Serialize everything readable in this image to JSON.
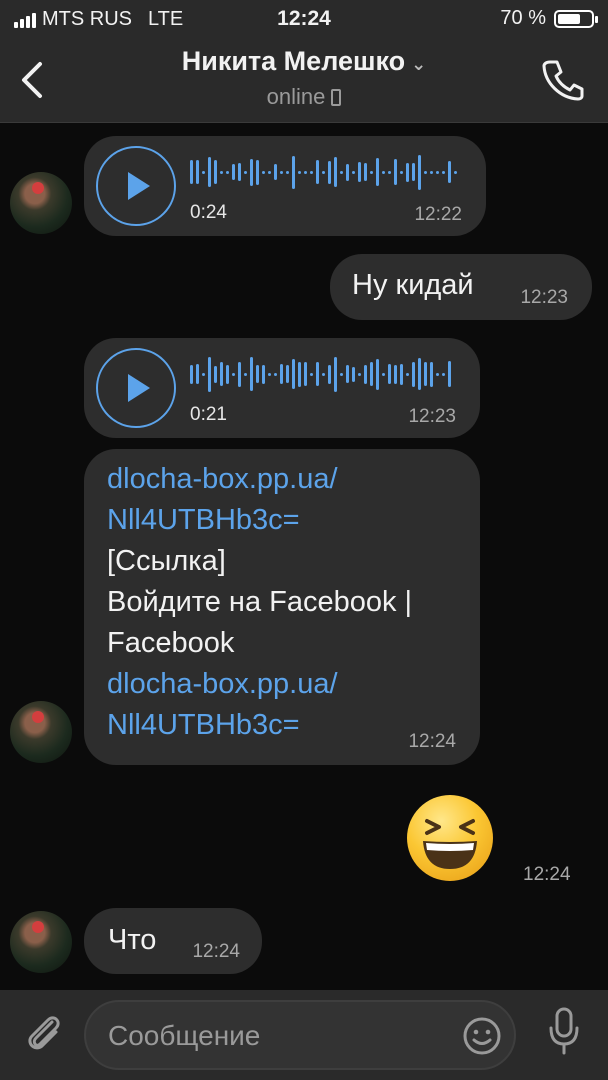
{
  "status_bar": {
    "carrier": "MTS RUS",
    "network": "LTE",
    "time": "12:24",
    "battery": "70 %",
    "battery_level": 0.7
  },
  "header": {
    "name": "Никита Мелешко",
    "status": "online",
    "back_icon": "chevron-left-icon",
    "call_icon": "phone-icon"
  },
  "messages": [
    {
      "type": "voice",
      "direction": "incoming",
      "duration": "0:24",
      "time": "12:22"
    },
    {
      "type": "text",
      "direction": "outgoing",
      "text": "Ну кидай",
      "time": "12:23"
    },
    {
      "type": "voice",
      "direction": "incoming",
      "duration": "0:21",
      "time": "12:23"
    },
    {
      "type": "link",
      "direction": "incoming",
      "lines": [
        "dlocha-box.pp.ua/",
        "Nll4UTBHb3c=",
        "[Ссылка]",
        "Войдите на Facebook |",
        "Facebook",
        "dlocha-box.pp.ua/",
        "Nll4UTBHb3c="
      ],
      "time": "12:24"
    },
    {
      "type": "sticker",
      "direction": "outgoing",
      "emoji": "grinning-squinting-face",
      "time": "12:24"
    },
    {
      "type": "text",
      "direction": "incoming",
      "text": "Что",
      "time": "12:24"
    }
  ],
  "composer": {
    "placeholder": "Сообщение",
    "attach_icon": "paperclip-icon",
    "emoji_icon": "smiley-icon",
    "mic_icon": "microphone-icon"
  },
  "colors": {
    "accent": "#5ca3ea",
    "bubble": "#2d2d2d",
    "background": "#0b0b0b",
    "bar": "#2a2a2a"
  }
}
